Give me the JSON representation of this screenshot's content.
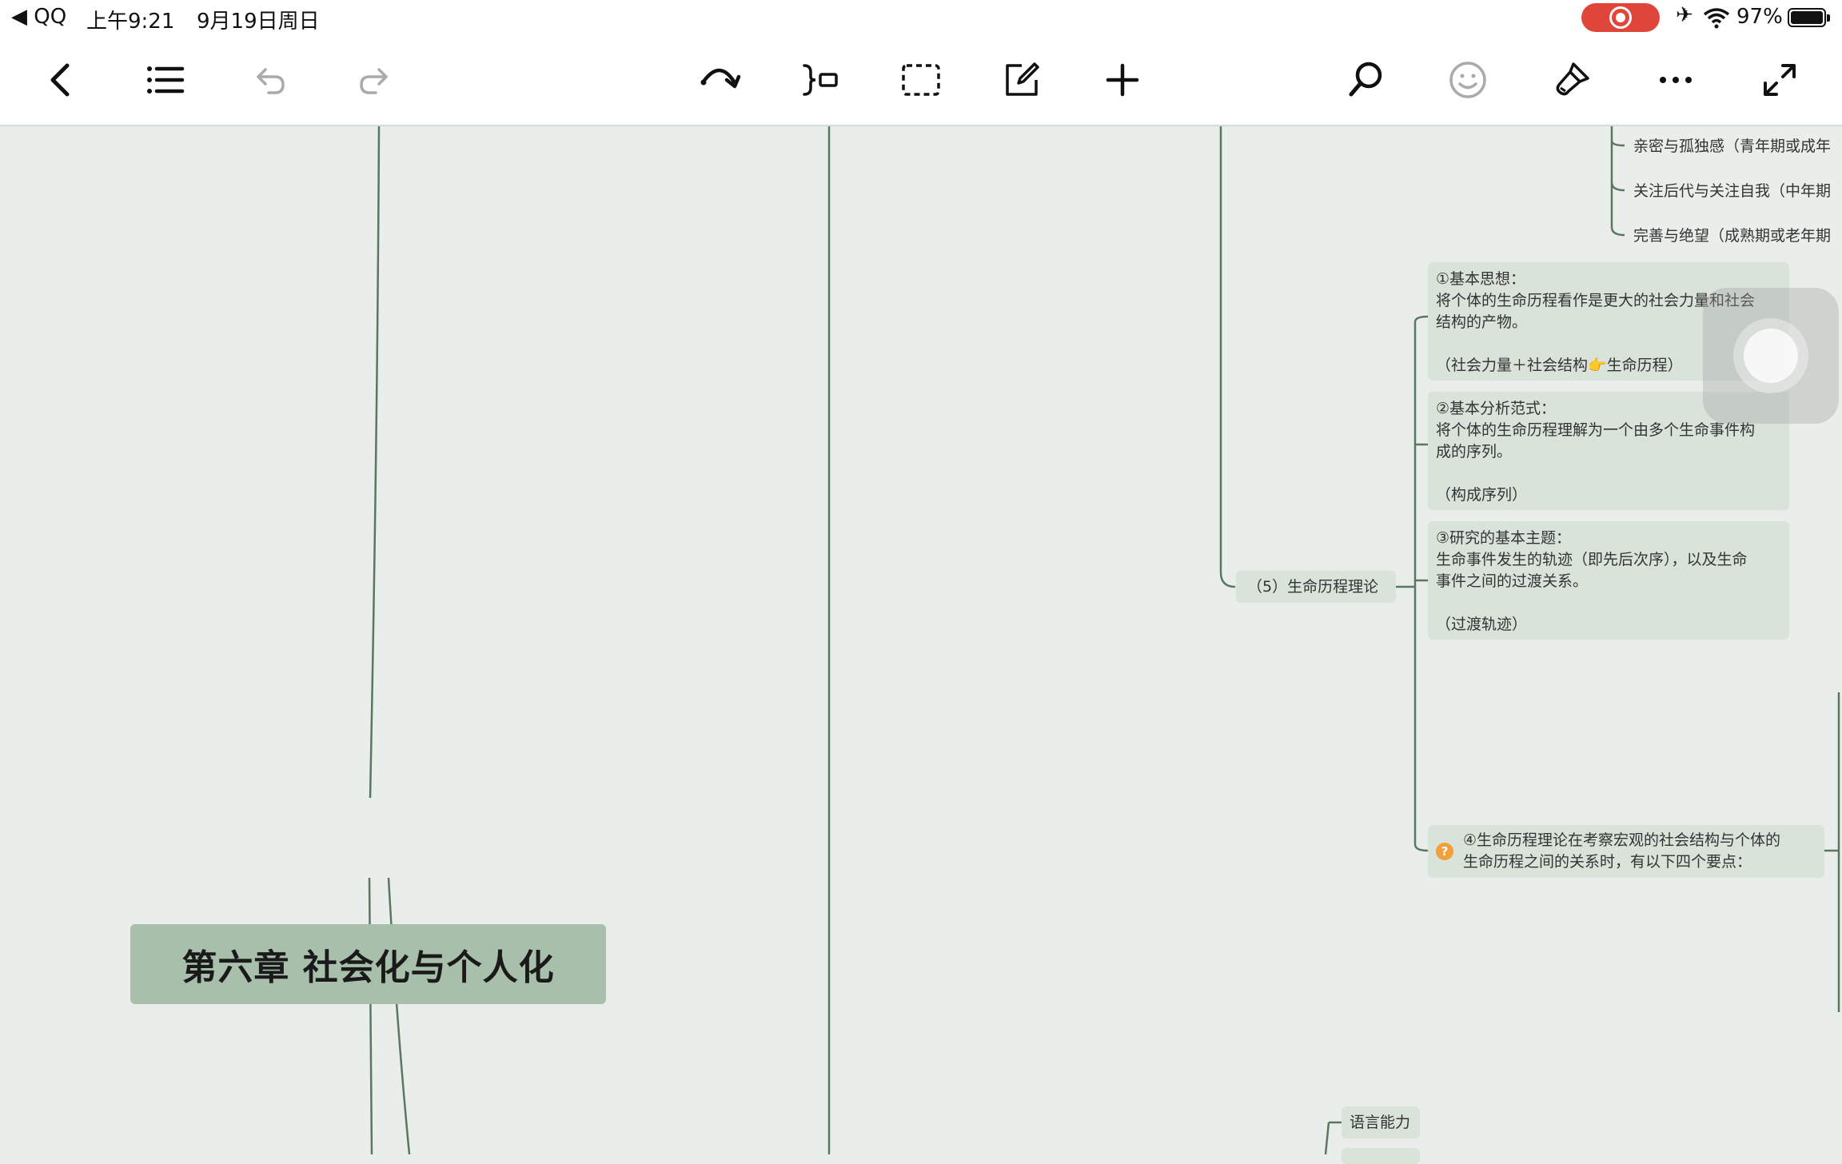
{
  "status_bar": {
    "back_app": "◀ QQ",
    "time": "上午9:21",
    "date": "9月19日周日",
    "battery": "97%",
    "recording_color": "#e0453a"
  },
  "toolbar": {
    "left_buttons": [
      "back-icon",
      "outline-list-icon",
      "undo-icon",
      "redo-icon"
    ],
    "center_buttons": [
      "relationship-arrow-icon",
      "summary-bracket-icon",
      "boundary-icon",
      "note-edit-icon",
      "add-topic-icon"
    ],
    "right_buttons": [
      "search-icon",
      "emoji-sticker-icon",
      "format-brush-icon",
      "more-icon",
      "fullscreen-icon"
    ]
  },
  "colors": {
    "canvas": "#e9eeea",
    "node_fill": "#d9e3da",
    "central_fill": "#a8bfab",
    "connector": "#5a7760"
  },
  "mindmap": {
    "central_topic": "第六章 社会化与个人化",
    "erikson_items": [
      "亲密与孤独感（青年期或成年",
      "关注后代与关注自我（中年期",
      "完善与绝望（成熟期或老年期"
    ],
    "life_course": {
      "title": "（5）生命历程理论",
      "points": [
        {
          "heading": "①基本思想：",
          "lines": [
            "将个体的生命历程看作是更大的社会力量和社会",
            "结构的产物。"
          ],
          "note": "（社会力量＋社会结构👉生命历程）"
        },
        {
          "heading": "②基本分析范式：",
          "lines": [
            "将个体的生命历程理解为一个由多个生命事件构",
            "成的序列。"
          ],
          "note": "（构成序列）"
        },
        {
          "heading": "③研究的基本主题：",
          "lines": [
            "生命事件发生的轨迹（即先后次序），以及生命",
            "事件之间的过渡关系。"
          ],
          "note": "（过渡轨迹）"
        }
      ],
      "point4": {
        "badge": "?",
        "lines": [
          "④生命历程理论在考察宏观的社会结构与个体的",
          "生命历程之间的关系时，有以下四个要点："
        ]
      }
    },
    "language_node": "语言能力"
  }
}
